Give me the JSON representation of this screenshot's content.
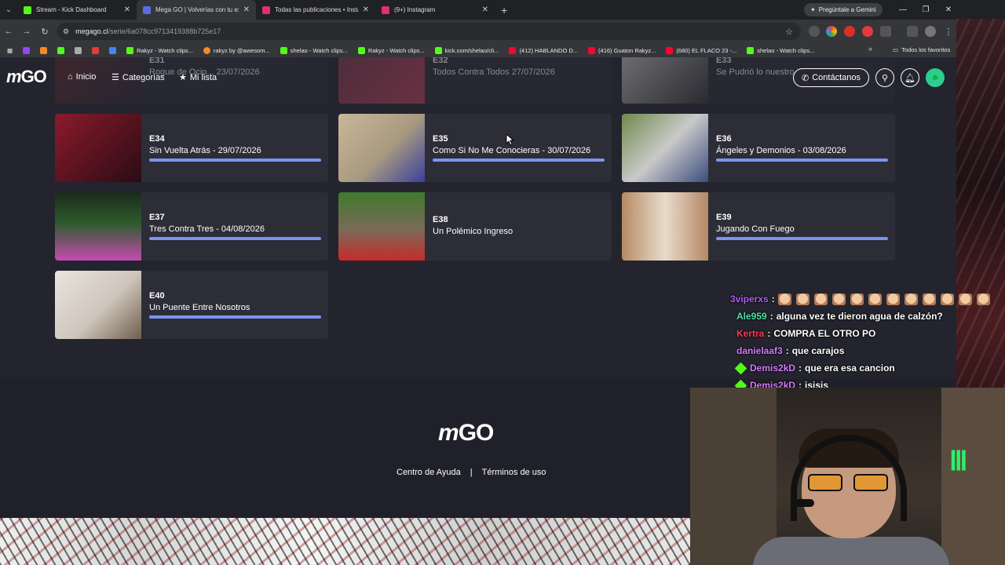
{
  "browser": {
    "tabs": [
      {
        "title": "Stream - Kick Dashboard",
        "favicon_color": "#53fc18",
        "active": false
      },
      {
        "title": "Mega GO | Volverías con tu ex",
        "favicon_color": "#5b6ee1",
        "active": true
      },
      {
        "title": "Todas las publicaciones • Instag",
        "favicon_color": "#e1306c",
        "active": false
      },
      {
        "title": "(9+) Instagram",
        "favicon_color": "#e1306c",
        "active": false
      }
    ],
    "gemini_label": "Pregúntale a Gemini",
    "url_host": "megago.cl",
    "url_path": "/serie/6a078cc9713419388b725e17",
    "bookmarks": [
      {
        "label": "Rakyz - Watch clips...",
        "color": "#53fc18"
      },
      {
        "label": "rakyz by @awesom...",
        "color": "#f28b2c"
      },
      {
        "label": "shelao - Watch clips...",
        "color": "#53fc18"
      },
      {
        "label": "Rakyz - Watch clips...",
        "color": "#53fc18"
      },
      {
        "label": "kick.com/shelao/cli...",
        "color": "#53fc18"
      },
      {
        "label": "(412) HABLANDO D...",
        "color": "#ff0033"
      },
      {
        "label": "(416) Guaton Rakyz...",
        "color": "#ff0033"
      },
      {
        "label": "(680) EL FLACO 23 -...",
        "color": "#ff0033"
      },
      {
        "label": "shelao - Watch clips...",
        "color": "#53fc18"
      }
    ],
    "bookmarks_all": "Todos los favoritos"
  },
  "site": {
    "logo_text": "GO",
    "nav": {
      "home": "Inicio",
      "categories": "Categorías",
      "mylist": "Mi lista",
      "contact": "Contáctanos"
    },
    "episodes_top_partial": [
      {
        "ep": "E31",
        "name": "Rogue de Ocio... 23/07/2026"
      },
      {
        "ep": "E32",
        "name": "Todos Contra Todos 27/07/2026"
      },
      {
        "ep": "E33",
        "name": "Se Pudrió lo nuestro"
      }
    ],
    "episodes": [
      {
        "ep": "E34",
        "name": "Sin Vuelta Atrás - 29/07/2026",
        "progress": 1.0,
        "thumb_a": "#8b1a2b",
        "thumb_b": "#2a0c14"
      },
      {
        "ep": "E35",
        "name": "Como Si No Me Conocieras - 30/07/2026",
        "progress": 1.0,
        "thumb_a": "#c8b79a",
        "thumb_b": "#3a3f9c"
      },
      {
        "ep": "E36",
        "name": "Ángeles y Demonios - 03/08/2026",
        "progress": 1.0,
        "thumb_a": "#6f8a4b",
        "thumb_b": "#3b4d7d"
      },
      {
        "ep": "E37",
        "name": "Tres Contra Tres - 04/08/2026",
        "progress": 1.0,
        "thumb_a": "#2c5b2c",
        "thumb_b": "#c64bb0"
      },
      {
        "ep": "E38",
        "name": "Un Polémico Ingreso",
        "progress": 0,
        "thumb_a": "#3f7a2c",
        "thumb_b": "#c62b2b"
      },
      {
        "ep": "E39",
        "name": "Jugando Con Fuego",
        "progress": 1.0,
        "thumb_a": "#b78a63",
        "thumb_b": "#e8dccb"
      },
      {
        "ep": "E40",
        "name": "Un Puente Entre Nosotros",
        "progress": 1.0,
        "thumb_a": "#e9e4df",
        "thumb_b": "#6e5f4d"
      }
    ],
    "footer": {
      "help": "Centro de Ayuda",
      "sep": "|",
      "terms": "Términos de uso"
    }
  },
  "chat": [
    {
      "user": "3viperxs",
      "color": "#b05cff",
      "text": "",
      "emotes": 12,
      "badge": false
    },
    {
      "user": "Ale959",
      "color": "#4be3a5",
      "text": "alguna vez te dieron agua de calzón?",
      "badge": false
    },
    {
      "user": "Kertra",
      "color": "#ff3b5c",
      "text": "COMPRA EL OTRO PO",
      "badge": false
    },
    {
      "user": "danielaaf3",
      "color": "#d778ff",
      "text": "que carajos",
      "badge": false
    },
    {
      "user": "Demis2kD",
      "color": "#d778ff",
      "text": "que era esa cancion",
      "badge": true
    },
    {
      "user": "Demis2kD",
      "color": "#d778ff",
      "text": "isisis",
      "badge": true
    }
  ],
  "colors": {
    "accent_progress": "#7d92f2",
    "card_bg": "#2c2d37",
    "page_bg": "#23242d"
  }
}
